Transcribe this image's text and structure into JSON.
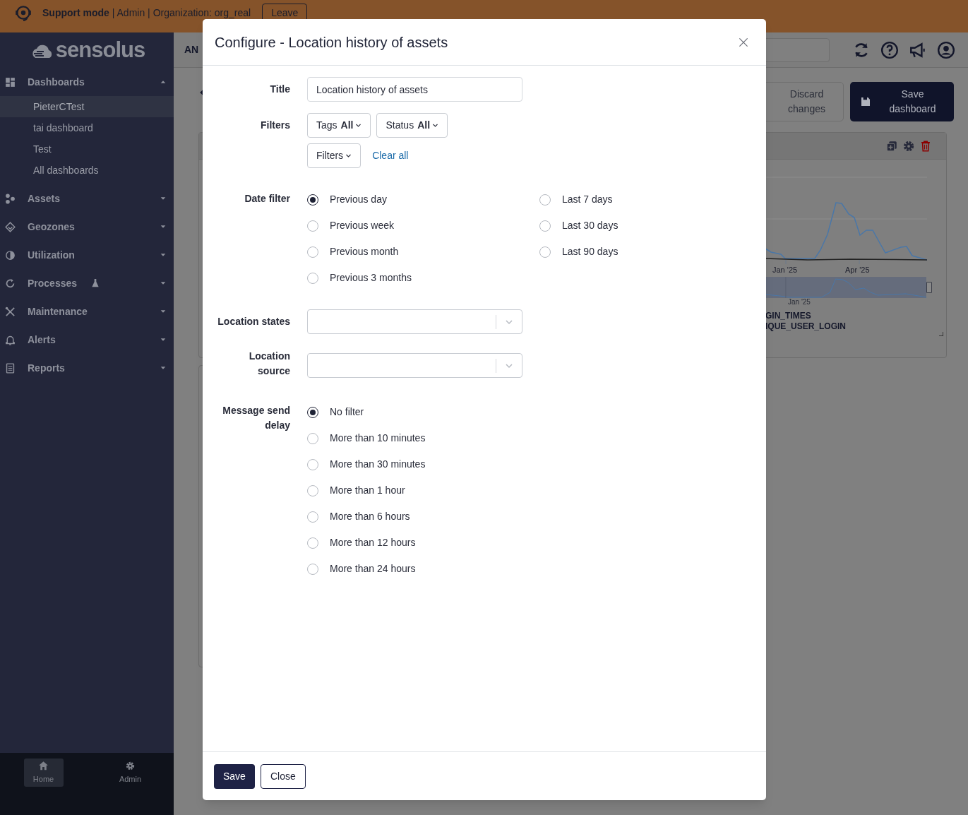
{
  "banner": {
    "text": "**Support mode** | Admin | Organization: org_real",
    "leave_button": "Leave"
  },
  "sidebar": {
    "logo": "sensolus",
    "sections": [
      {
        "label": "Dashboards",
        "expanded": true,
        "experimental": false,
        "children": [
          {
            "label": "PieterCTest",
            "selected": true
          },
          {
            "label": "tai dashboard",
            "selected": false
          },
          {
            "label": "Test",
            "selected": false
          },
          {
            "label": "All dashboards",
            "selected": false
          }
        ]
      },
      {
        "label": "Assets",
        "expanded": false,
        "experimental": false
      },
      {
        "label": "Geozones",
        "expanded": false,
        "experimental": false
      },
      {
        "label": "Utilization",
        "expanded": false,
        "experimental": false
      },
      {
        "label": "Processes",
        "expanded": false,
        "experimental": true
      },
      {
        "label": "Maintenance",
        "expanded": false,
        "experimental": false
      },
      {
        "label": "Alerts",
        "expanded": false,
        "experimental": false
      },
      {
        "label": "Reports",
        "expanded": false,
        "experimental": false
      }
    ],
    "bottom": [
      {
        "label": "Home",
        "selected": true
      },
      {
        "label": "Admin",
        "selected": false
      }
    ]
  },
  "main": {
    "header_text": "AN",
    "discard_button": "Discard changes",
    "save_button": "Save dashboard",
    "widget": {
      "x_labels": [
        "Jan '25",
        "Apr '25"
      ],
      "navigator_label": "Jan '25",
      "legend": [
        "GIN_TIMES",
        "IQUE_USER_LOGIN"
      ]
    }
  },
  "modal": {
    "title": "Configure - Location history of assets",
    "title_field": {
      "label": "Title",
      "value": "Location history of assets"
    },
    "filters": {
      "label": "Filters",
      "dropdowns": [
        {
          "label": "Tags",
          "value": "All"
        },
        {
          "label": "Status",
          "value": "All"
        }
      ],
      "more_button": "Filters",
      "clear_link": "Clear all"
    },
    "date_filter": {
      "label": "Date filter",
      "options": [
        {
          "label": "Previous day",
          "selected": true
        },
        {
          "label": "Previous week",
          "selected": false
        },
        {
          "label": "Previous month",
          "selected": false
        },
        {
          "label": "Previous 3 months",
          "selected": false
        },
        {
          "label": "Last 7 days",
          "selected": false
        },
        {
          "label": "Last 30 days",
          "selected": false
        },
        {
          "label": "Last 90 days",
          "selected": false
        }
      ]
    },
    "location_states": {
      "label": "Location states"
    },
    "location_source": {
      "label": "Location source"
    },
    "message_delay": {
      "label": "Message send delay",
      "options": [
        {
          "label": "No filter",
          "selected": true
        },
        {
          "label": "More than 10 minutes",
          "selected": false
        },
        {
          "label": "More than 30 minutes",
          "selected": false
        },
        {
          "label": "More than 1 hour",
          "selected": false
        },
        {
          "label": "More than 6 hours",
          "selected": false
        },
        {
          "label": "More than 12 hours",
          "selected": false
        },
        {
          "label": "More than 24 hours",
          "selected": false
        }
      ]
    },
    "save_button": "Save",
    "close_button": "Close"
  }
}
